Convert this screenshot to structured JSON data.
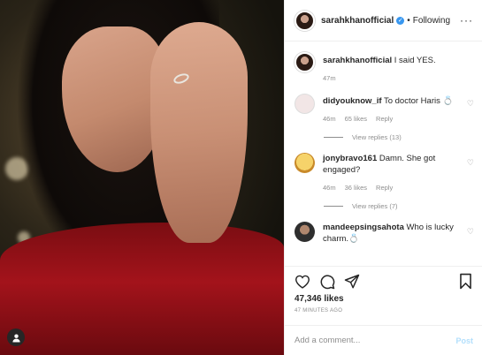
{
  "header": {
    "username": "sarahkhanofficial",
    "separator": "•",
    "follow_label": "Following",
    "more_label": "···"
  },
  "caption": {
    "username": "sarahkhanofficial",
    "text": "I said YES.",
    "time": "47m"
  },
  "comments": [
    {
      "username": "didyouknow_if",
      "text": "To doctor Haris 💍",
      "time": "46m",
      "likes": "65 likes",
      "reply": "Reply",
      "view_replies": "View replies (13)",
      "avatar_color": "#f2e6e6"
    },
    {
      "username": "jonybravo161",
      "text": "Damn. She got engaged?",
      "time": "46m",
      "likes": "36 likes",
      "reply": "Reply",
      "view_replies": "View replies (7)",
      "avatar_color": "#f3c64b"
    },
    {
      "username": "mandeepsingsahota",
      "text": "Who is lucky charm.💍",
      "avatar_color": "#3a3a3a"
    }
  ],
  "post": {
    "likes": "47,346 likes",
    "time": "47 MINUTES AGO",
    "add_comment_placeholder": "Add a comment...",
    "post_label": "Post"
  },
  "colors": {
    "accent": "#3897f0",
    "post_disabled": "#b2dffc",
    "dress": "#a3131b"
  },
  "icons": {
    "actions": [
      "heart-icon",
      "comment-icon",
      "share-icon",
      "bookmark-icon"
    ],
    "photo": "user-tag-icon"
  }
}
